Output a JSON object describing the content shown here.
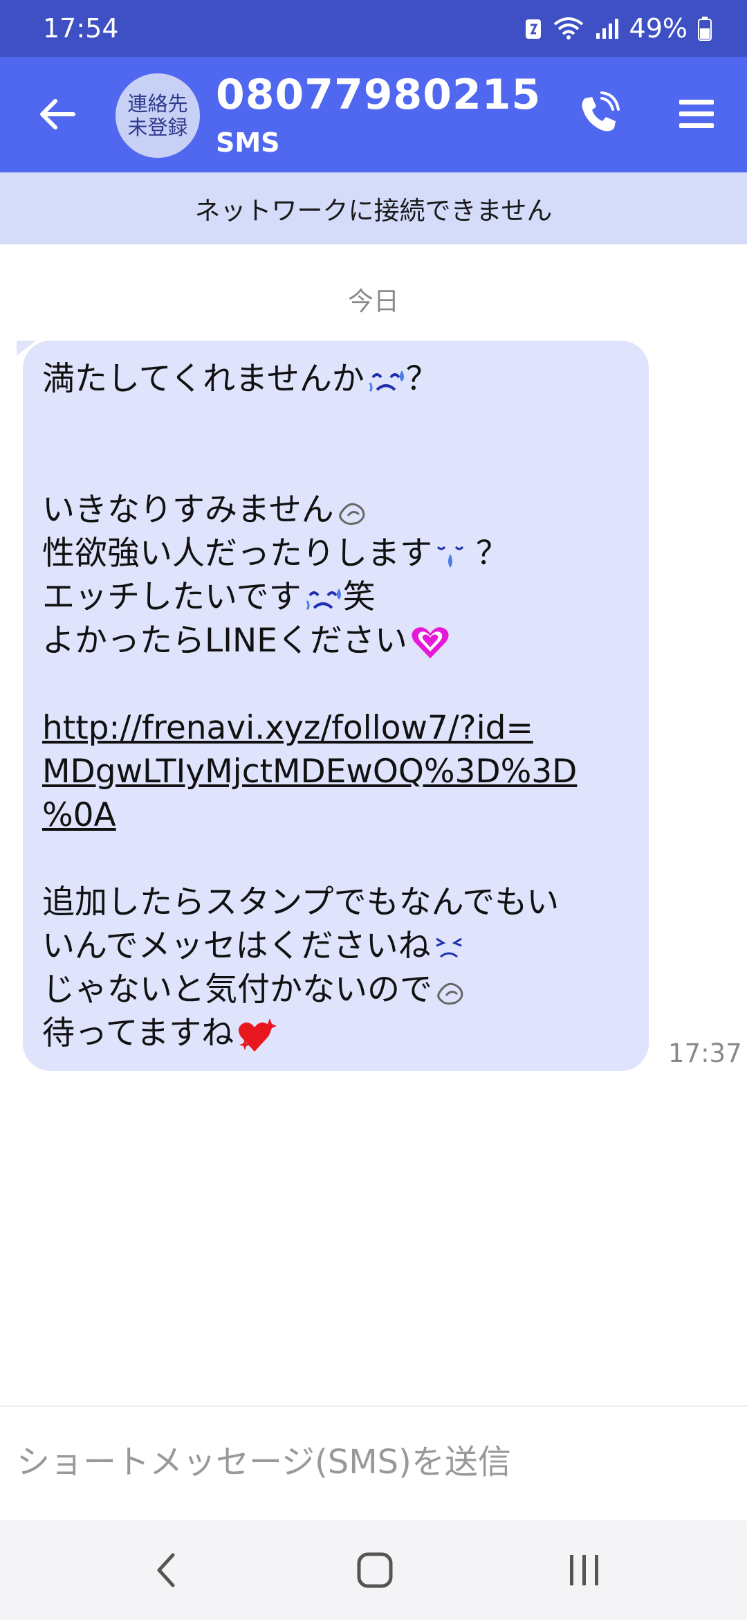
{
  "status_bar": {
    "time": "17:54",
    "battery": "49%"
  },
  "header": {
    "avatar_text_line1": "連絡先",
    "avatar_text_line2": "未登録",
    "contact_number": "08077980215",
    "channel": "SMS"
  },
  "network_banner": "ネットワークに接続できません",
  "date_separator": "今日",
  "message": {
    "lines": [
      "満たしてくれませんか",
      "？",
      "いきなりすみません",
      "性欲強い人だったりします",
      "エッチしたいです",
      "笑",
      "よかったらLINEください",
      "http://frenavi.xyz/follow7/?id=",
      "MDgwLTIyMjctMDEwOQ%3D%3D",
      "%0A",
      "追加したらスタンプでもなんでもい",
      "いんでメッセはくださいね",
      "じゃないと気付かないので",
      "待ってますね"
    ],
    "time": "17:37"
  },
  "input": {
    "placeholder": "ショートメッセージ(SMS)を送信"
  },
  "colors": {
    "status_bar": "#3f50c4",
    "app_bar": "#5068ef",
    "banner": "#d4dcfa",
    "bubble": "#dfe3fb"
  },
  "icons": [
    "back-arrow-icon",
    "phone-call-icon",
    "menu-icon",
    "sweat-face-emoji",
    "sweat-drop-emoji",
    "tear-face-emoji",
    "heart-emoji",
    "sparkle-heart-emoji",
    "nav-back-icon",
    "nav-home-icon",
    "nav-recents-icon",
    "wifi-icon",
    "signal-icon",
    "battery-icon",
    "battery-saver-icon"
  ]
}
